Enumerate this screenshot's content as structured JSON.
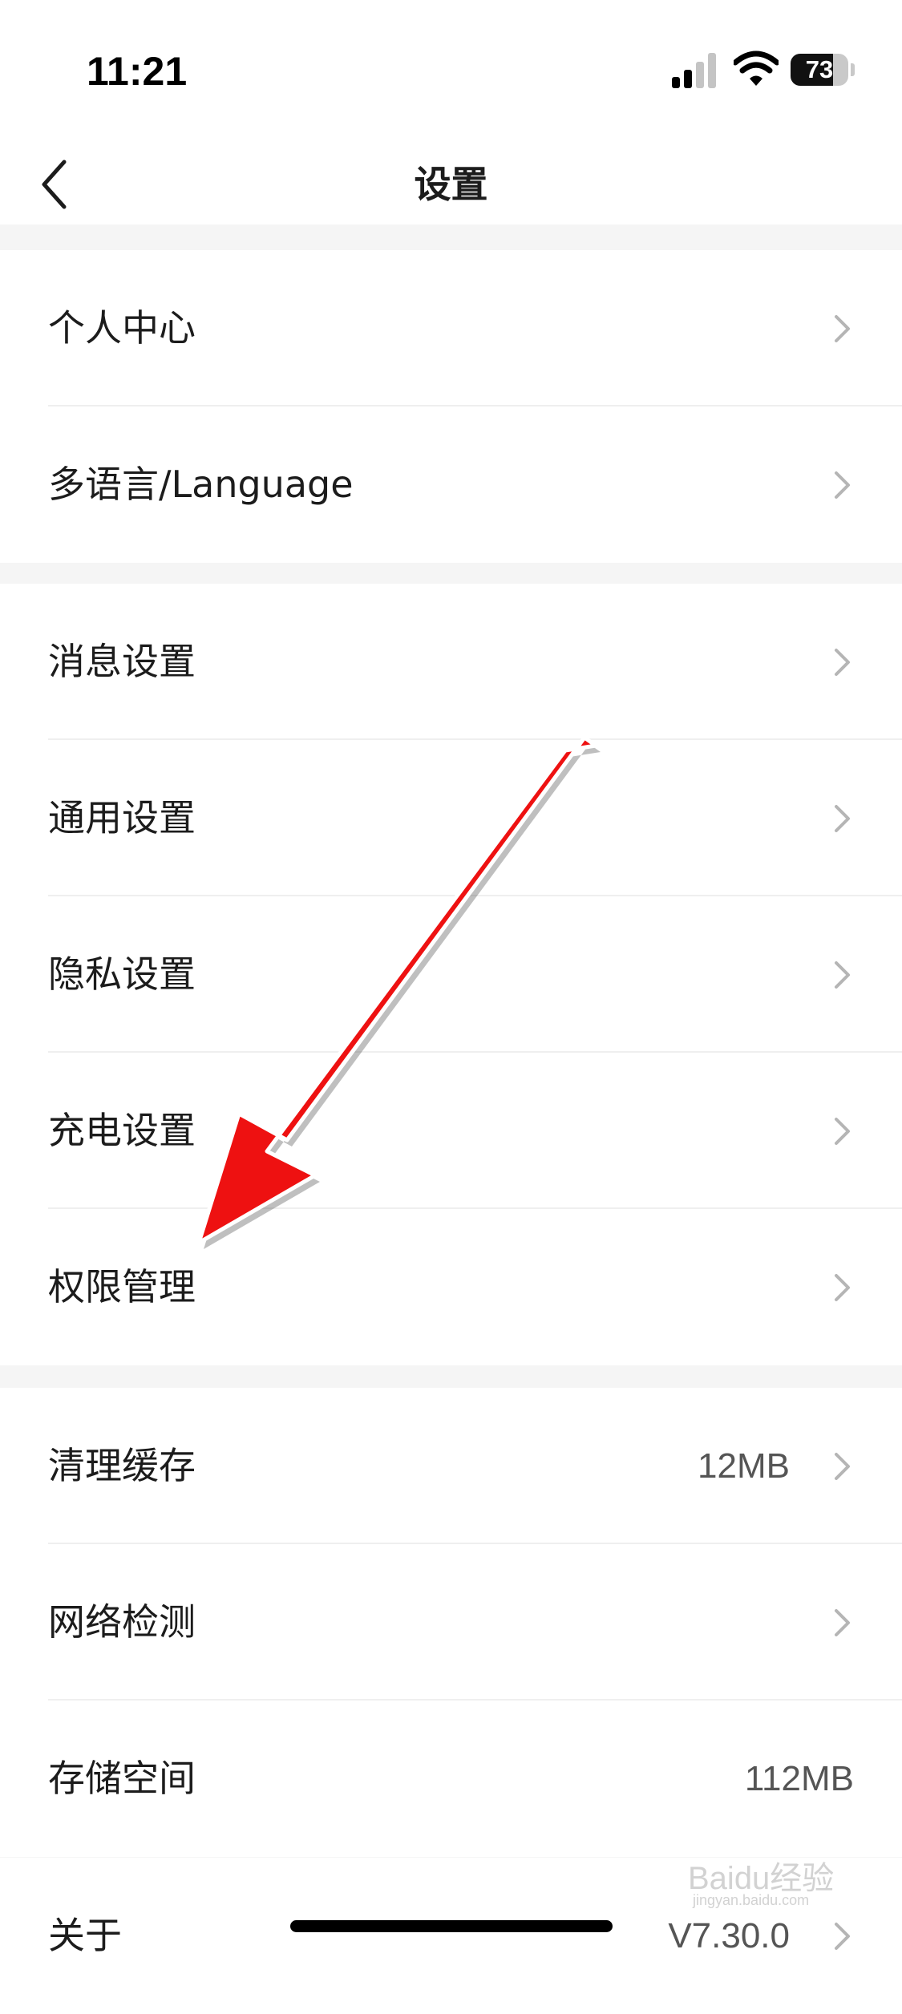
{
  "status_bar": {
    "time": "11:21",
    "battery_percent": 73,
    "battery_label": "73",
    "icons": [
      "cellular-signal-icon",
      "wifi-icon",
      "battery-icon"
    ]
  },
  "nav": {
    "title": "设置",
    "back_icon": "chevron-left-icon"
  },
  "groups": [
    {
      "items": [
        {
          "label": "个人中心"
        },
        {
          "label": "多语言/Language"
        }
      ]
    },
    {
      "items": [
        {
          "label": "消息设置"
        },
        {
          "label": "通用设置"
        },
        {
          "label": "隐私设置"
        },
        {
          "label": "充电设置"
        },
        {
          "label": "权限管理"
        }
      ]
    },
    {
      "items": [
        {
          "label": "清理缓存",
          "value": "12MB"
        },
        {
          "label": "网络检测"
        },
        {
          "label": "存储空间",
          "value": "112MB"
        }
      ]
    },
    {
      "items": [
        {
          "label": "关于",
          "value": "V7.30.0"
        }
      ]
    }
  ],
  "annotation": {
    "color": "#ee1111",
    "points_to": "权限管理"
  },
  "watermark": {
    "text": "Baidu经验",
    "subtext": "jingyan.baidu.com"
  },
  "colors": {
    "background": "#f5f5f5",
    "card": "#ffffff",
    "text": "#1c1c1c",
    "secondary_text": "#555555",
    "chevron": "#b5b5b5"
  }
}
